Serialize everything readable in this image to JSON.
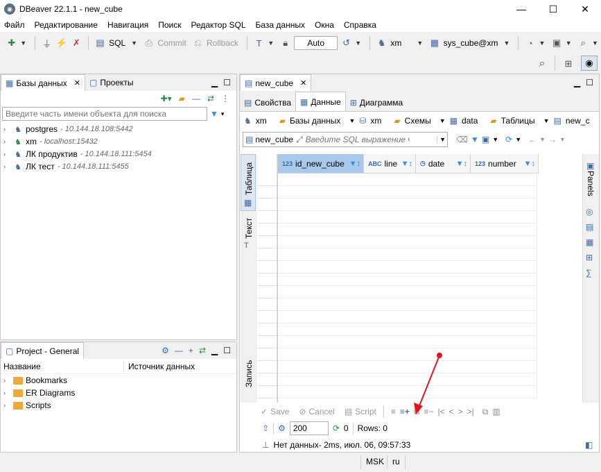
{
  "window": {
    "title": "DBeaver 22.1.1 - new_cube"
  },
  "menu": [
    "Файл",
    "Редактирование",
    "Навигация",
    "Поиск",
    "Редактор SQL",
    "База данных",
    "Окна",
    "Справка"
  ],
  "toolbar": {
    "sql_label": "SQL",
    "commit_label": "Commit",
    "rollback_label": "Rollback",
    "transaction_mode": "Auto",
    "datasource": "xm",
    "schema": "sys_cube@xm"
  },
  "left": {
    "tabs": [
      "Базы данных",
      "Проекты"
    ],
    "search_placeholder": "Введите часть имени объекта для поиска",
    "connections": [
      {
        "name": "postgres",
        "host": "- 10.144.18.108:5442"
      },
      {
        "name": "xm",
        "host": "- localhost:15432"
      },
      {
        "name": "ЛК продуктив",
        "host": "- 10.144.18.111:5454"
      },
      {
        "name": "ЛК тест",
        "host": "- 10.144.18.111:5455"
      }
    ]
  },
  "project": {
    "title": "Project - General",
    "col_name": "Название",
    "col_source": "Источник данных",
    "items": [
      "Bookmarks",
      "ER Diagrams",
      "Scripts"
    ]
  },
  "editor": {
    "tab": "new_cube",
    "subtabs": [
      "Свойства",
      "Данные",
      "Диаграмма"
    ],
    "breadcrumb": [
      "xm",
      "Базы данных",
      "xm",
      "Схемы",
      "data",
      "Таблицы",
      "new_c"
    ],
    "table_name": "new_cube",
    "filter_placeholder": "Введите SQL выражение ч",
    "columns": [
      {
        "type": "123",
        "name": "id_new_cube"
      },
      {
        "type": "ABC",
        "name": "line"
      },
      {
        "type": "◷",
        "name": "date"
      },
      {
        "type": "123",
        "name": "number"
      }
    ],
    "side_labels": [
      "Таблица",
      "Текст",
      "Запись"
    ],
    "right_label": "Panels",
    "bottom": {
      "save": "Save",
      "cancel": "Cancel",
      "script": "Script",
      "fetch_size": "200",
      "refresh_count": "0",
      "rows": "Rows: 0",
      "status": "Нет данных- 2ms, июл. 06, 09:57:33"
    }
  },
  "statusbar": {
    "tz": "MSK",
    "lang": "ru"
  },
  "colors": {
    "accent": "#3c8ad8",
    "selected_col": "#a8c8ec",
    "arrow": "#e0141e"
  }
}
